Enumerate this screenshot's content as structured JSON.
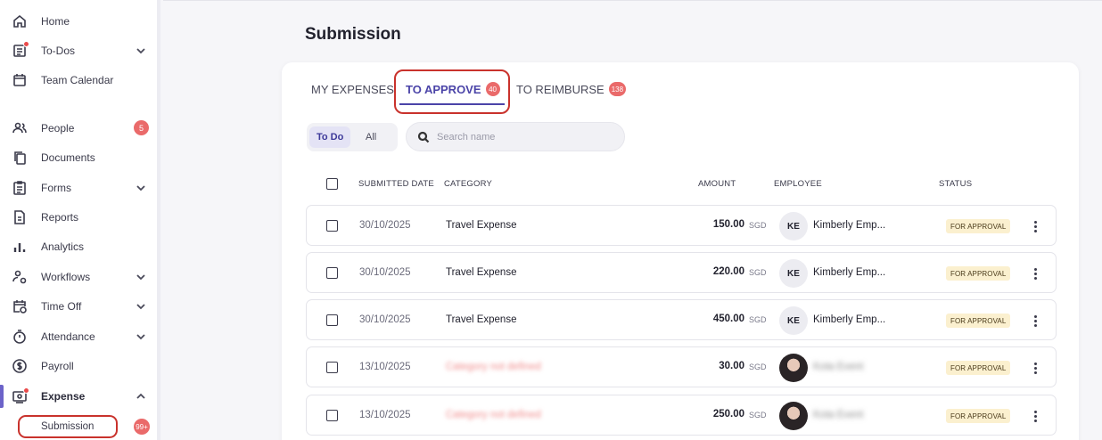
{
  "sidebar": {
    "items": [
      {
        "label": "Home",
        "icon": "home-icon",
        "chevron": false
      },
      {
        "label": "To-Dos",
        "icon": "todo-list-icon",
        "chevron": true,
        "dot": true
      },
      {
        "label": "Team Calendar",
        "icon": "calendar-icon",
        "chevron": false
      },
      {
        "label": "People",
        "icon": "people-icon",
        "badge": "5"
      },
      {
        "label": "Documents",
        "icon": "documents-icon",
        "chevron": false
      },
      {
        "label": "Forms",
        "icon": "forms-icon",
        "chevron": true
      },
      {
        "label": "Reports",
        "icon": "reports-icon",
        "chevron": false
      },
      {
        "label": "Analytics",
        "icon": "analytics-icon",
        "chevron": false
      },
      {
        "label": "Workflows",
        "icon": "workflows-icon",
        "chevron": true
      },
      {
        "label": "Time Off",
        "icon": "time-off-icon",
        "chevron": true
      },
      {
        "label": "Attendance",
        "icon": "stopwatch-icon",
        "chevron": true
      },
      {
        "label": "Payroll",
        "icon": "payroll-icon",
        "chevron": false
      },
      {
        "label": "Expense",
        "icon": "expense-icon",
        "chevron": "up",
        "dot": true,
        "active": true
      }
    ],
    "sub_item": {
      "label": "Submission",
      "badge": "99+"
    }
  },
  "page": {
    "title": "Submission"
  },
  "tabs": [
    {
      "label": "MY EXPENSES"
    },
    {
      "label": "TO APPROVE",
      "badge": "40",
      "active": true
    },
    {
      "label": "TO REIMBURSE",
      "badge": "138"
    }
  ],
  "filters": {
    "todo": "To Do",
    "all": "All"
  },
  "search": {
    "placeholder": "Search name"
  },
  "table": {
    "headers": {
      "submitted_date": "SUBMITTED DATE",
      "category": "CATEGORY",
      "amount": "AMOUNT",
      "employee": "EMPLOYEE",
      "status": "STATUS"
    },
    "rows": [
      {
        "date": "30/10/2025",
        "category": "Travel Expense",
        "amount": "150.00",
        "currency": "SGD",
        "initials": "KE",
        "employee": "Kimberly Emp...",
        "status": "FOR APPROVAL"
      },
      {
        "date": "30/10/2025",
        "category": "Travel Expense",
        "amount": "220.00",
        "currency": "SGD",
        "initials": "KE",
        "employee": "Kimberly Emp...",
        "status": "FOR APPROVAL"
      },
      {
        "date": "30/10/2025",
        "category": "Travel Expense",
        "amount": "450.00",
        "currency": "SGD",
        "initials": "KE",
        "employee": "Kimberly Emp...",
        "status": "FOR APPROVAL"
      },
      {
        "date": "13/10/2025",
        "category": "Category not defined",
        "amount": "30.00",
        "currency": "SGD",
        "initials": "",
        "employee": "Kota Event",
        "status": "FOR APPROVAL",
        "blurred": true
      },
      {
        "date": "13/10/2025",
        "category": "Category not defined",
        "amount": "250.00",
        "currency": "SGD",
        "initials": "",
        "employee": "Kota Event",
        "status": "FOR APPROVAL",
        "blurred": true
      }
    ]
  },
  "colors": {
    "accent": "#4b44a8",
    "badge": "#ea6a6a",
    "highlight": "#c9322c",
    "status_bg": "#fbf0cf"
  }
}
